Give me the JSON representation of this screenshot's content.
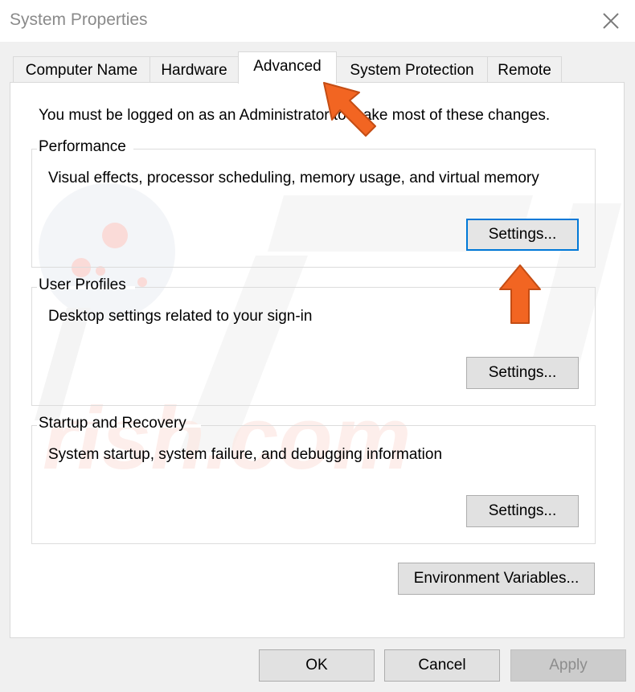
{
  "window": {
    "title": "System Properties",
    "close_icon": "close-x-icon"
  },
  "tabs": [
    {
      "label": "Computer Name",
      "active": false
    },
    {
      "label": "Hardware",
      "active": false
    },
    {
      "label": "Advanced",
      "active": true
    },
    {
      "label": "System Protection",
      "active": false
    },
    {
      "label": "Remote",
      "active": false
    }
  ],
  "advanced": {
    "notice": "You must be logged on as an Administrator to make most of these changes.",
    "groups": [
      {
        "label": "Performance",
        "description": "Visual effects, processor scheduling, memory usage, and virtual memory",
        "button_label": "Settings...",
        "focused": true
      },
      {
        "label": "User Profiles",
        "description": "Desktop settings related to your sign-in",
        "button_label": "Settings...",
        "focused": false
      },
      {
        "label": "Startup and Recovery",
        "description": "System startup, system failure, and debugging information",
        "button_label": "Settings...",
        "focused": false
      }
    ],
    "env_button_label": "Environment Variables..."
  },
  "footer": {
    "ok_label": "OK",
    "cancel_label": "Cancel",
    "apply_label": "Apply",
    "apply_enabled": false
  },
  "annotations": {
    "arrow_color": "#f26522",
    "arrows": [
      {
        "points_to": "Advanced tab",
        "icon": "arrow-up-left-icon"
      },
      {
        "points_to": "Performance Settings button",
        "icon": "arrow-up-icon"
      }
    ]
  },
  "colors": {
    "focus_border": "#0078d7",
    "window_bg": "#f0f0f0",
    "panel_bg": "#ffffff",
    "title_text": "#8a8a8a"
  }
}
